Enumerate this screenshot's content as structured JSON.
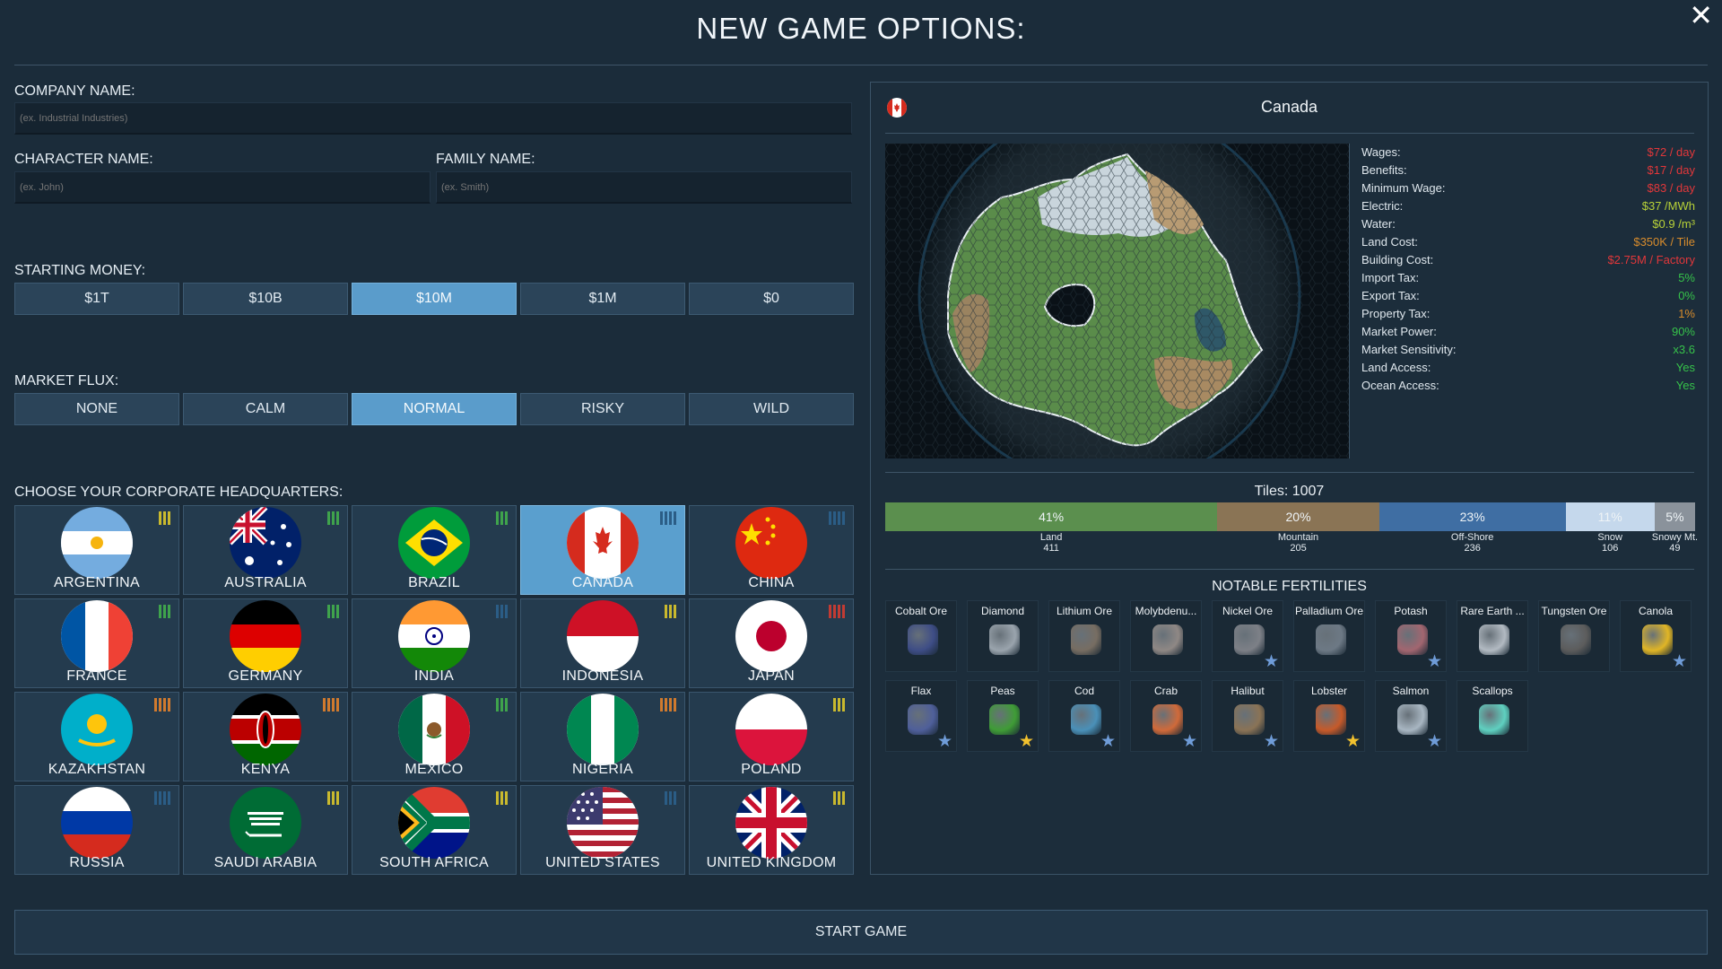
{
  "title": "NEW GAME OPTIONS:",
  "company": {
    "label": "COMPANY NAME:",
    "placeholder": "(ex. Industrial Industries)"
  },
  "character": {
    "label": "CHARACTER NAME:",
    "placeholder": "(ex. John)"
  },
  "family": {
    "label": "FAMILY NAME:",
    "placeholder": "(ex. Smith)"
  },
  "money": {
    "label": "STARTING MONEY:",
    "options": [
      "$1T",
      "$10B",
      "$10M",
      "$1M",
      "$0"
    ],
    "selected": "$10M"
  },
  "flux": {
    "label": "MARKET FLUX:",
    "options": [
      "NONE",
      "CALM",
      "NORMAL",
      "RISKY",
      "WILD"
    ],
    "selected": "NORMAL"
  },
  "hq": {
    "label": "CHOOSE YOUR CORPORATE HEADQUARTERS:",
    "selected": "CANADA",
    "countries": [
      {
        "name": "ARGENTINA",
        "flag": "argentina",
        "difficulty_color": "#c9b92e",
        "difficulty_level": 3
      },
      {
        "name": "AUSTRALIA",
        "flag": "australia",
        "difficulty_color": "#3fa34c",
        "difficulty_level": 3
      },
      {
        "name": "BRAZIL",
        "flag": "brazil",
        "difficulty_color": "#3fa34c",
        "difficulty_level": 3
      },
      {
        "name": "CANADA",
        "flag": "canada",
        "difficulty_color": "#2b5d86",
        "difficulty_level": 4
      },
      {
        "name": "CHINA",
        "flag": "china",
        "difficulty_color": "#2b5d86",
        "difficulty_level": 4
      },
      {
        "name": "FRANCE",
        "flag": "france",
        "difficulty_color": "#3fa34c",
        "difficulty_level": 3
      },
      {
        "name": "GERMANY",
        "flag": "germany",
        "difficulty_color": "#3fa34c",
        "difficulty_level": 3
      },
      {
        "name": "INDIA",
        "flag": "india",
        "difficulty_color": "#2b5d86",
        "difficulty_level": 3
      },
      {
        "name": "INDONESIA",
        "flag": "indonesia",
        "difficulty_color": "#c9b92e",
        "difficulty_level": 3
      },
      {
        "name": "JAPAN",
        "flag": "japan",
        "difficulty_color": "#c23b33",
        "difficulty_level": 4
      },
      {
        "name": "KAZAKHSTAN",
        "flag": "kazakhstan",
        "difficulty_color": "#d07a2e",
        "difficulty_level": 4
      },
      {
        "name": "KENYA",
        "flag": "kenya",
        "difficulty_color": "#d07a2e",
        "difficulty_level": 4
      },
      {
        "name": "MEXICO",
        "flag": "mexico",
        "difficulty_color": "#3fa34c",
        "difficulty_level": 3
      },
      {
        "name": "NIGERIA",
        "flag": "nigeria",
        "difficulty_color": "#d07a2e",
        "difficulty_level": 4
      },
      {
        "name": "POLAND",
        "flag": "poland",
        "difficulty_color": "#c9b92e",
        "difficulty_level": 3
      },
      {
        "name": "RUSSIA",
        "flag": "russia",
        "difficulty_color": "#2b5d86",
        "difficulty_level": 4
      },
      {
        "name": "SAUDI ARABIA",
        "flag": "saudi",
        "difficulty_color": "#c9b92e",
        "difficulty_level": 3
      },
      {
        "name": "SOUTH AFRICA",
        "flag": "southafrica",
        "difficulty_color": "#c9b92e",
        "difficulty_level": 3
      },
      {
        "name": "UNITED STATES",
        "flag": "usa",
        "difficulty_color": "#2b5d86",
        "difficulty_level": 3
      },
      {
        "name": "UNITED KINGDOM",
        "flag": "uk",
        "difficulty_color": "#c9b92e",
        "difficulty_level": 3
      }
    ]
  },
  "panel": {
    "country": "Canada",
    "stats": [
      {
        "k": "Wages:",
        "v": "$72 / day",
        "color": "#e2373a"
      },
      {
        "k": "Benefits:",
        "v": "$17 / day",
        "color": "#e2373a"
      },
      {
        "k": "Minimum Wage:",
        "v": "$83 / day",
        "color": "#e2373a"
      },
      {
        "k": "Electric:",
        "v": "$37 /MWh",
        "color": "#b8d238"
      },
      {
        "k": "Water:",
        "v": "$0.9 /m³",
        "color": "#b8d238"
      },
      {
        "k": "Land Cost:",
        "v": "$350K / Tile",
        "color": "#d88c2c"
      },
      {
        "k": "Building Cost:",
        "v": "$2.75M / Factory",
        "color": "#e2373a"
      },
      {
        "k": "Import Tax:",
        "v": "5%",
        "color": "#36c24a"
      },
      {
        "k": "Export Tax:",
        "v": "0%",
        "color": "#36c24a"
      },
      {
        "k": "Property Tax:",
        "v": "1%",
        "color": "#d88c2c"
      },
      {
        "k": "Market Power:",
        "v": "90%",
        "color": "#36c24a"
      },
      {
        "k": "Market Sensitivity:",
        "v": "x3.6",
        "color": "#36c24a"
      },
      {
        "k": "Land Access:",
        "v": "Yes",
        "color": "#36c24a"
      },
      {
        "k": "Ocean Access:",
        "v": "Yes",
        "color": "#36c24a"
      }
    ],
    "tiles_label": "Tiles:  1007",
    "tile_breakdown": [
      {
        "pct": "41%",
        "name": "Land",
        "count": "411",
        "fraction": 0.41,
        "color": "#5b8f4e"
      },
      {
        "pct": "20%",
        "name": "Mountain",
        "count": "205",
        "fraction": 0.2,
        "color": "#8a7455"
      },
      {
        "pct": "23%",
        "name": "Off-Shore",
        "count": "236",
        "fraction": 0.23,
        "color": "#3f6ea3"
      },
      {
        "pct": "11%",
        "name": "Snow",
        "count": "106",
        "fraction": 0.11,
        "color": "#c5d8ec"
      },
      {
        "pct": "5%",
        "name": "Snowy Mt.",
        "count": "49",
        "fraction": 0.05,
        "color": "#8a929b"
      }
    ],
    "fertilities_label": "NOTABLE FERTILITIES",
    "fertilities": [
      {
        "name": "Cobalt Ore",
        "icon": "cobalt-ore-icon",
        "color": "#3e4d86",
        "star": ""
      },
      {
        "name": "Diamond",
        "icon": "diamond-icon",
        "color": "#9aa4ad",
        "star": ""
      },
      {
        "name": "Lithium Ore",
        "icon": "lithium-ore-icon",
        "color": "#776d62",
        "star": ""
      },
      {
        "name": "Molybdenu...",
        "icon": "molybdenum-icon",
        "color": "#8f8885",
        "star": ""
      },
      {
        "name": "Nickel Ore",
        "icon": "nickel-ore-icon",
        "color": "#7d8087",
        "star": "blue"
      },
      {
        "name": "Palladium Ore",
        "icon": "palladium-ore-icon",
        "color": "#6d7985",
        "star": ""
      },
      {
        "name": "Potash",
        "icon": "potash-icon",
        "color": "#a26670",
        "star": "blue"
      },
      {
        "name": "Rare Earth ...",
        "icon": "rare-earth-icon",
        "color": "#b2bac2",
        "star": ""
      },
      {
        "name": "Tungsten Ore",
        "icon": "tungsten-ore-icon",
        "color": "#5c5c5c",
        "star": ""
      },
      {
        "name": "Canola",
        "icon": "canola-icon",
        "color": "#e0b526",
        "star": "blue"
      },
      {
        "name": "Flax",
        "icon": "flax-icon",
        "color": "#4f5f9a",
        "star": "blue"
      },
      {
        "name": "Peas",
        "icon": "peas-icon",
        "color": "#3f9c36",
        "star": "gold"
      },
      {
        "name": "Cod",
        "icon": "cod-icon",
        "color": "#4a90b8",
        "star": "blue"
      },
      {
        "name": "Crab",
        "icon": "crab-icon",
        "color": "#d06a3a",
        "star": "blue"
      },
      {
        "name": "Halibut",
        "icon": "halibut-icon",
        "color": "#8a7356",
        "star": "blue"
      },
      {
        "name": "Lobster",
        "icon": "lobster-icon",
        "color": "#c65a2a",
        "star": "gold"
      },
      {
        "name": "Salmon",
        "icon": "salmon-icon",
        "color": "#a8b6c2",
        "star": "blue"
      },
      {
        "name": "Scallops",
        "icon": "scallops-icon",
        "color": "#5fd0c0",
        "star": ""
      }
    ]
  },
  "start_label": "START GAME"
}
